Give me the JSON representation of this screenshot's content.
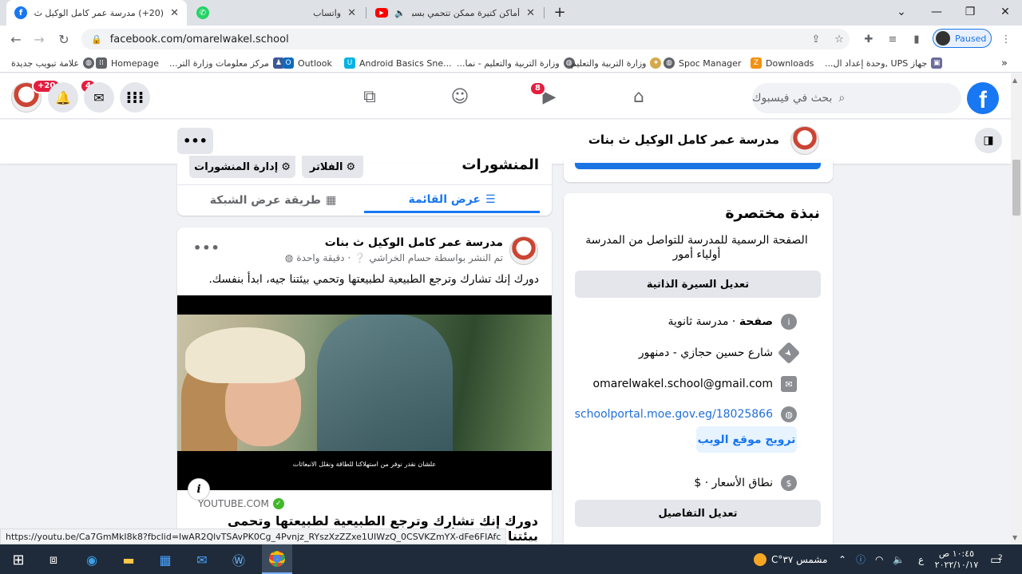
{
  "browser": {
    "tabs": [
      {
        "title": "(20+) مدرسة عمر كامل الوكيل ث بنات | ..."
      },
      {
        "title": "واتساب"
      },
      {
        "title": "أماكن كتيرة ممكن تتحمي بسبب تغير الـ..."
      }
    ],
    "url": "facebook.com/omarelwakel.school",
    "profile_label": "Paused"
  },
  "bookmarks": [
    {
      "label": "علامة تبويب جديدة"
    },
    {
      "label": "Homepage"
    },
    {
      "label": "مركز معلومات وزارة التر..."
    },
    {
      "label": "Outlook"
    },
    {
      "label": "Android Basics Sne..."
    },
    {
      "label": "وزارة التربية والتعليم - نما..."
    },
    {
      "label": "وزارة التربية والتعليم"
    },
    {
      "label": "Spoc Manager"
    },
    {
      "label": "Downloads"
    },
    {
      "label": "جهاز UPS ,وحدة إعداد ال..."
    }
  ],
  "header": {
    "search_placeholder": "بحث في فيسبوك",
    "logo_letter": "f",
    "notif_badge": "+20",
    "bell_badge": "4",
    "messenger_badge": "4",
    "watch_badge": "8"
  },
  "page": {
    "name": "مدرسة عمر كامل الوكيل ث بنات",
    "more": "•••"
  },
  "posts_bar": {
    "title": "المنشورات",
    "filters_label": "الفلاتر",
    "manage_label": "إدارة المنشورات",
    "list_view": "عرض القائمة",
    "grid_view": "طريقة عرض الشبكة"
  },
  "post": {
    "author": "مدرسة عمر كامل الوكيل ث بنات",
    "meta": "تم النشر بواسطة حسام الخراشي",
    "time": "دقيقة واحدة",
    "text": "دورك إنك تشارك وترجع الطبيعية لطبيعتها وتحمي بيئتنا جيه، ابدأ بنفسك.",
    "video_subtitle": "علشان نقدر نوفر من استهلاكنا للطاقة ونقلل الانبعاثات",
    "link_source": "YOUTUBE.COM",
    "link_title": "دورك إنك تشارك وترجع الطبيعية لطبيعتها وتحمى بيئتنا جيه، ابدأ بنفسك.",
    "info_icon": "i"
  },
  "intro": {
    "title": "نبذة مختصرة",
    "description": "الصفحة الرسمية للمدرسة للتواصل من المدرسة أولياء أمور",
    "edit_bio": "تعديل السيرة الذاتية",
    "category_bold": "صفحة",
    "category": " · مدرسة ثانوية",
    "address": "شارع حسين حجازي - دمنهور",
    "email": "omarelwakel.school@gmail.com",
    "website": "schoolportal.moe.gov.eg/18025866",
    "promote_site": "ترويج موقع الويب",
    "price_range": "نطاق الأسعار · $",
    "edit_details": "تعديل التفاصيل"
  },
  "status_url": "https://youtu.be/Ca7GmMkI8k8?fbclid=IwAR2QlvTSAvPK0Cg_4Pvnjz_RYszXzZZxe1UIWzQ_0CSVKZmYX-dFe6FIAfc",
  "taskbar": {
    "weather": "مشمس ٣٧°C",
    "lang": "ع",
    "time": "١٠:٤٥ ص",
    "date": "٢٠٢٢/١٠/١٧",
    "notif_count": "2"
  }
}
